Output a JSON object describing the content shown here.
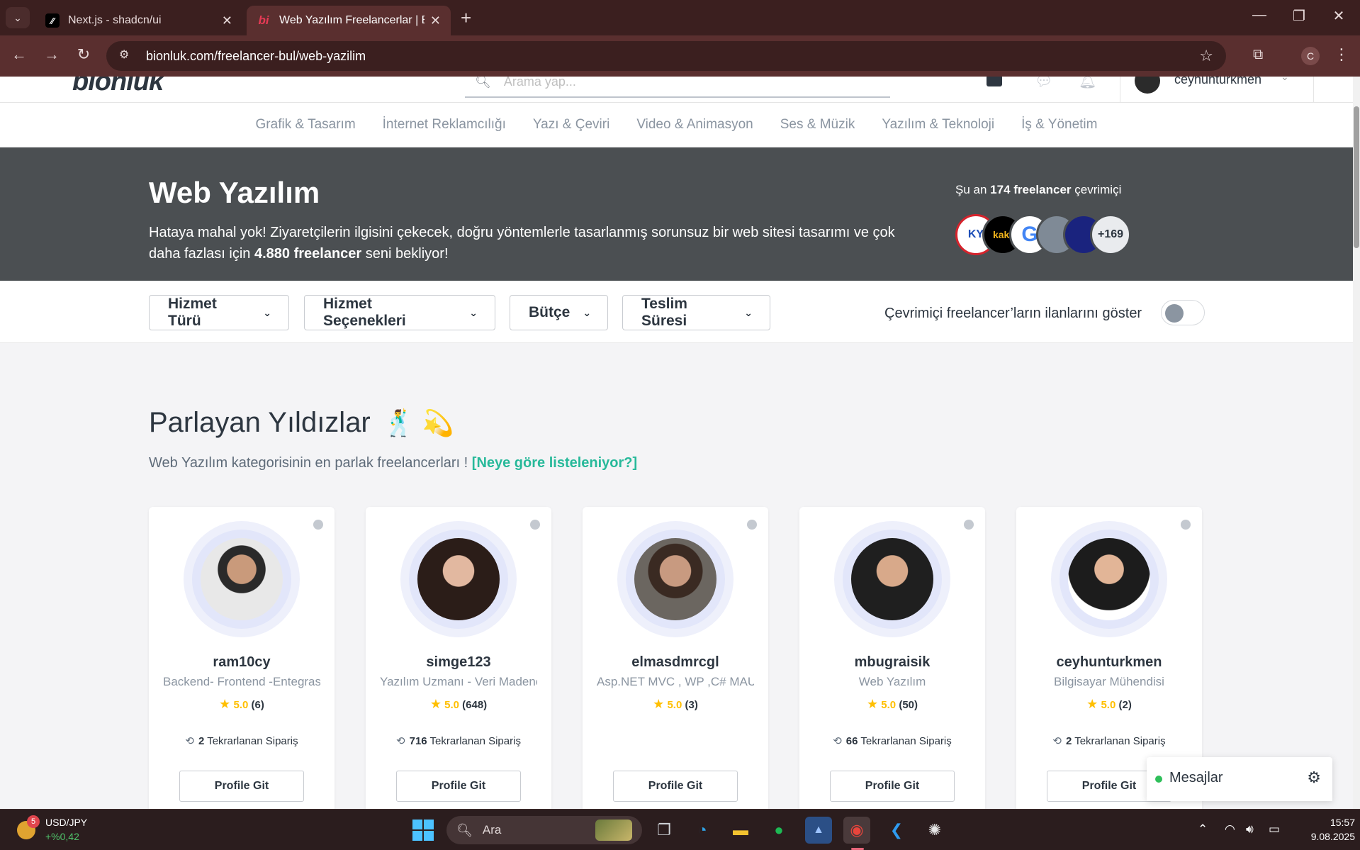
{
  "browser": {
    "tabs": [
      {
        "title": "Next.js - shadcn/ui",
        "active": false
      },
      {
        "title": "Web Yazılım Freelancerlar | Bionluk",
        "active": true
      }
    ],
    "url": "bionluk.com/freelancer-bul/web-yazilim",
    "profile_initial": "C"
  },
  "site": {
    "logo": "bionluk",
    "search_placeholder": "Arama yap...",
    "username": "ceyhunturkmen"
  },
  "categories": [
    "Grafik & Tasarım",
    "İnternet Reklamcılığı",
    "Yazı & Çeviri",
    "Video & Animasyon",
    "Ses & Müzik",
    "Yazılım & Teknoloji",
    "İş & Yönetim"
  ],
  "hero": {
    "title": "Web Yazılım",
    "desc_part1": "Hataya mahal yok! Ziyaretçilerin ilgisini çekecek, doğru yöntemlerle tasarlanmış sorunsuz bir web sitesi tasarımı ve çok daha fazlası için ",
    "desc_bold": "4.880 freelancer",
    "desc_part2": " seni bekliyor!",
    "online_prefix": "Şu an ",
    "online_bold": "174 freelancer",
    "online_suffix": " çevrimiçi",
    "more_count": "+169"
  },
  "filters": {
    "buttons": [
      "Hizmet Türü",
      "Hizmet Seçenekleri",
      "Bütçe",
      "Teslim Süresi"
    ],
    "toggle_label": "Çevrimiçi freelancer’ların ilanlarını göster",
    "toggle_on": false
  },
  "section": {
    "title": "Parlayan Yıldızlar",
    "emoji": "🕺 💫",
    "subtitle": "Web Yazılım kategorisinin en parlak freelancerları ! ",
    "link": "[Neye göre listeleniyor?]"
  },
  "freelancers": [
    {
      "name": "ram10cy",
      "title": "Backend- Frontend -Entegrasyon",
      "score": "5.0",
      "count": "(6)",
      "repeat": "2",
      "repeat_label": "Tekrarlanan Sipariş",
      "button": "Profile Git"
    },
    {
      "name": "simge123",
      "title": "Yazılım Uzmanı - Veri Madenciliği",
      "score": "5.0",
      "count": "(648)",
      "repeat": "716",
      "repeat_label": "Tekrarlanan Sipariş",
      "button": "Profile Git"
    },
    {
      "name": "elmasdmrcgl",
      "title": "Asp.NET MVC , WP ,C# MAUI",
      "score": "5.0",
      "count": "(3)",
      "repeat": "",
      "repeat_label": "",
      "button": "Profile Git"
    },
    {
      "name": "mbugraisik",
      "title": "Web Yazılım",
      "score": "5.0",
      "count": "(50)",
      "repeat": "66",
      "repeat_label": "Tekrarlanan Sipariş",
      "button": "Profile Git"
    },
    {
      "name": "ceyhunturkmen",
      "title": "Bilgisayar Mühendisi",
      "score": "5.0",
      "count": "(2)",
      "repeat": "2",
      "repeat_label": "Tekrarlanan Sipariş",
      "button": "Profile Git"
    }
  ],
  "messages_widget": {
    "label": "Mesajlar"
  },
  "taskbar": {
    "ticker_badge": "5",
    "ticker_symbol": "USD/JPY",
    "ticker_change": "+%0,42",
    "search_label": "Ara",
    "time": "15:57",
    "date": "9.08.2025"
  },
  "colors": {
    "accent": "#27b99a",
    "hero_bg": "#4b4f52",
    "star": "#ffbf00",
    "text_dark": "#2d3640"
  }
}
